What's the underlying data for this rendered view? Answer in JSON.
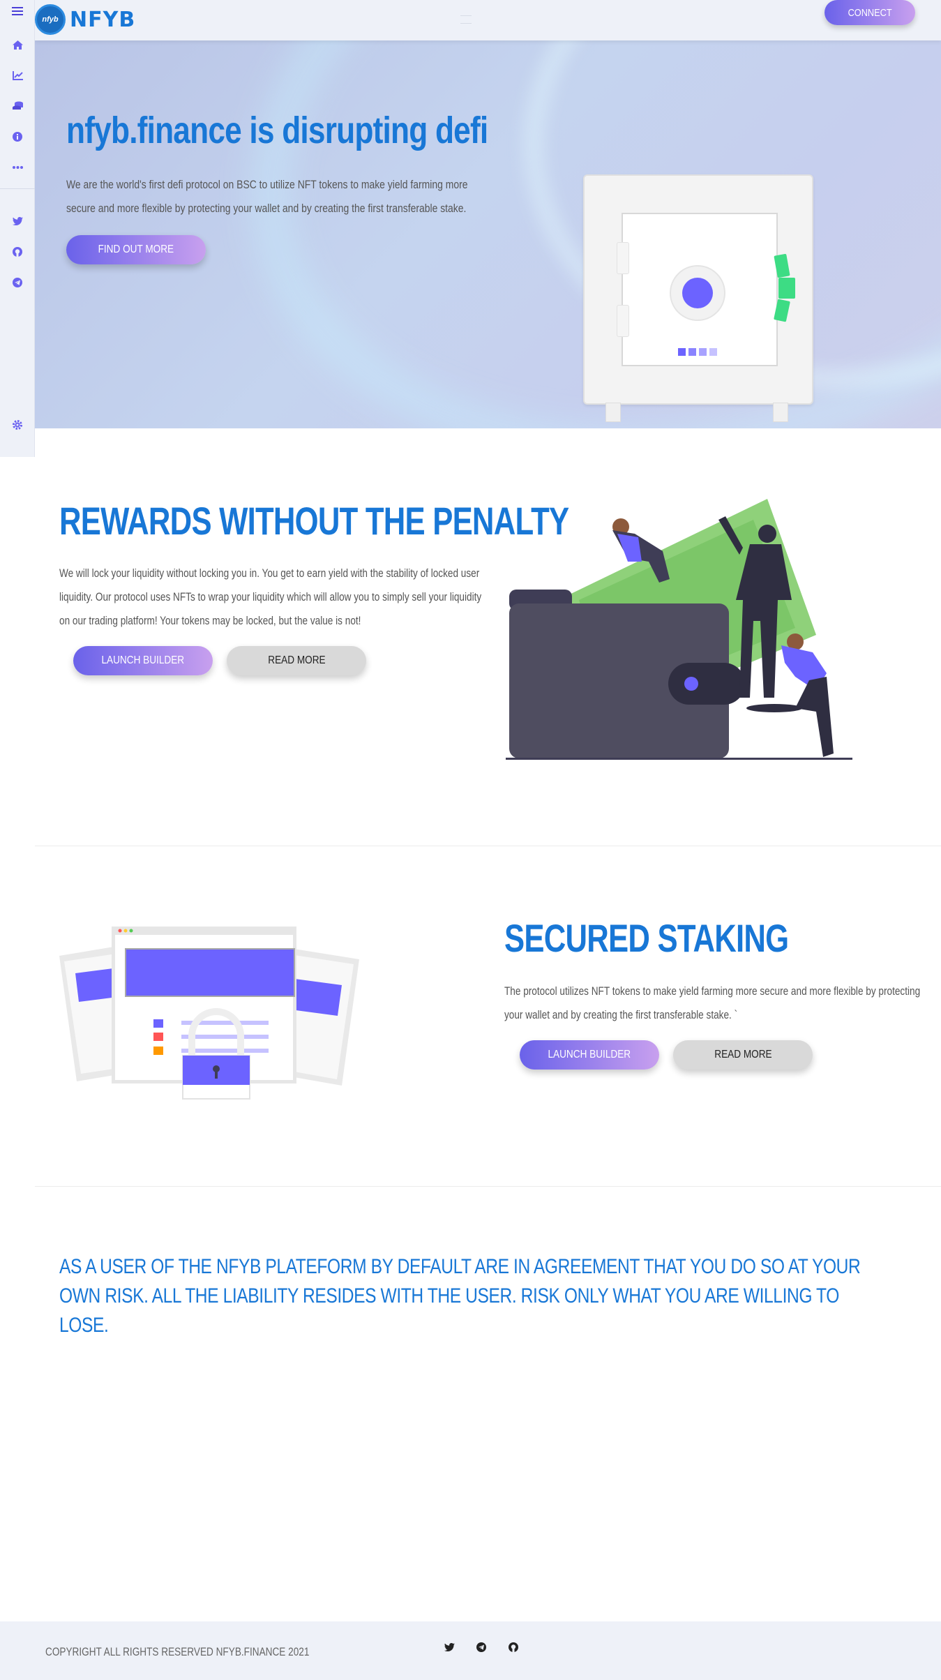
{
  "brand": {
    "logo_text": "NFYB",
    "badge_text": "nfyb"
  },
  "header": {
    "connect_label": "CONNECT"
  },
  "sidebar": {
    "icons": [
      "menu-icon",
      "home-icon",
      "chart-icon",
      "coins-icon",
      "info-icon",
      "more-icon",
      "twitter-icon",
      "github-icon",
      "telegram-icon",
      "settings-icon"
    ]
  },
  "hero": {
    "title": "nfyb.finance is disrupting defi",
    "description": "We are the world's first defi protocol on BSC to utilize NFT tokens to make yield farming more secure and more flexible by protecting your wallet and by creating the first transferable stake.",
    "cta_label": "FIND OUT MORE"
  },
  "rewards": {
    "title": "REWARDS WITHOUT THE PENALTY",
    "description": "We will lock your liquidity without locking you in. You get to earn yield with the stability of locked user liquidity. Our protocol uses NFTs to wrap your liquidity which will allow you to simply sell your liquidity on our trading platform! Your tokens may be locked, but the value is not!",
    "launch_label": "LAUNCH BUILDER",
    "read_label": "READ MORE"
  },
  "staking": {
    "title": "SECURED STAKING",
    "description": "The protocol utilizes NFT tokens to make yield farming more secure and more flexible by protecting your wallet and by creating the first transferable stake. `",
    "launch_label": "LAUNCH BUILDER",
    "read_label": "READ MORE"
  },
  "disclaimer": "AS A USER OF THE NFYB PLATEFORM BY DEFAULT ARE IN AGREEMENT THAT YOU DO SO AT YOUR OWN RISK. ALL THE LIABILITY RESIDES WITH THE USER. RISK ONLY WHAT YOU ARE WILLING TO LOSE.",
  "footer": {
    "copyright": "COPYRIGHT ALL RIGHTS RESERVED NFYB.FINANCE 2021",
    "icons": [
      "twitter-icon",
      "telegram-icon",
      "github-icon"
    ]
  },
  "colors": {
    "accent": "#1877d6",
    "gradient_start": "#6a62ea",
    "gradient_end": "#c8a0ee",
    "illustration": "#6c63ff"
  }
}
